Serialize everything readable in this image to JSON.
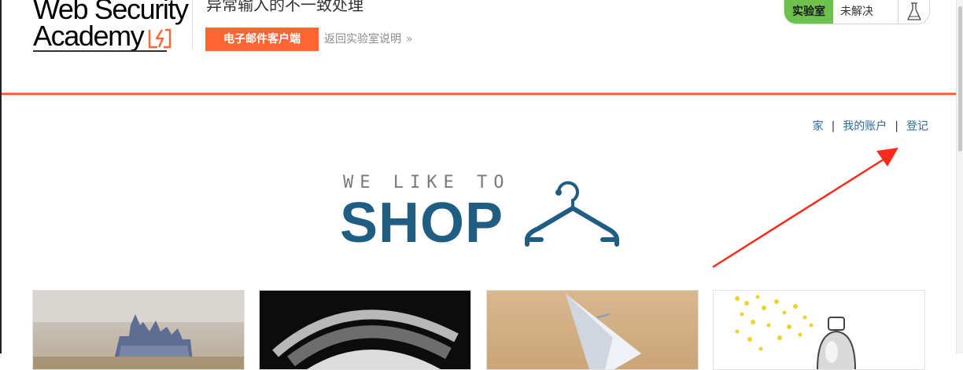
{
  "header": {
    "logo_line1": "Web Security",
    "logo_line2": "Academy",
    "lab_title": "异常输入的不一致处理",
    "email_client_button": "电子邮件客户端",
    "back_link": "返回实验室说明",
    "back_chevron": "»",
    "lab_status": {
      "label": "实验室",
      "value": "未解决"
    }
  },
  "nav": {
    "home": "家",
    "account": "我的账户",
    "login": "登记",
    "separator": "|"
  },
  "hero": {
    "tagline": "WE LIKE TO",
    "title": "SHOP"
  },
  "products": [
    {
      "name": "castle-image"
    },
    {
      "name": "eye-image"
    },
    {
      "name": "paper-plane-image"
    },
    {
      "name": "spray-bottle-image"
    }
  ],
  "colors": {
    "brand_orange": "#ff6633",
    "status_green": "#6cc24a",
    "shop_blue": "#1f5e82",
    "link_blue": "#2a6ba8",
    "annotation_red": "#ff2a1a"
  }
}
